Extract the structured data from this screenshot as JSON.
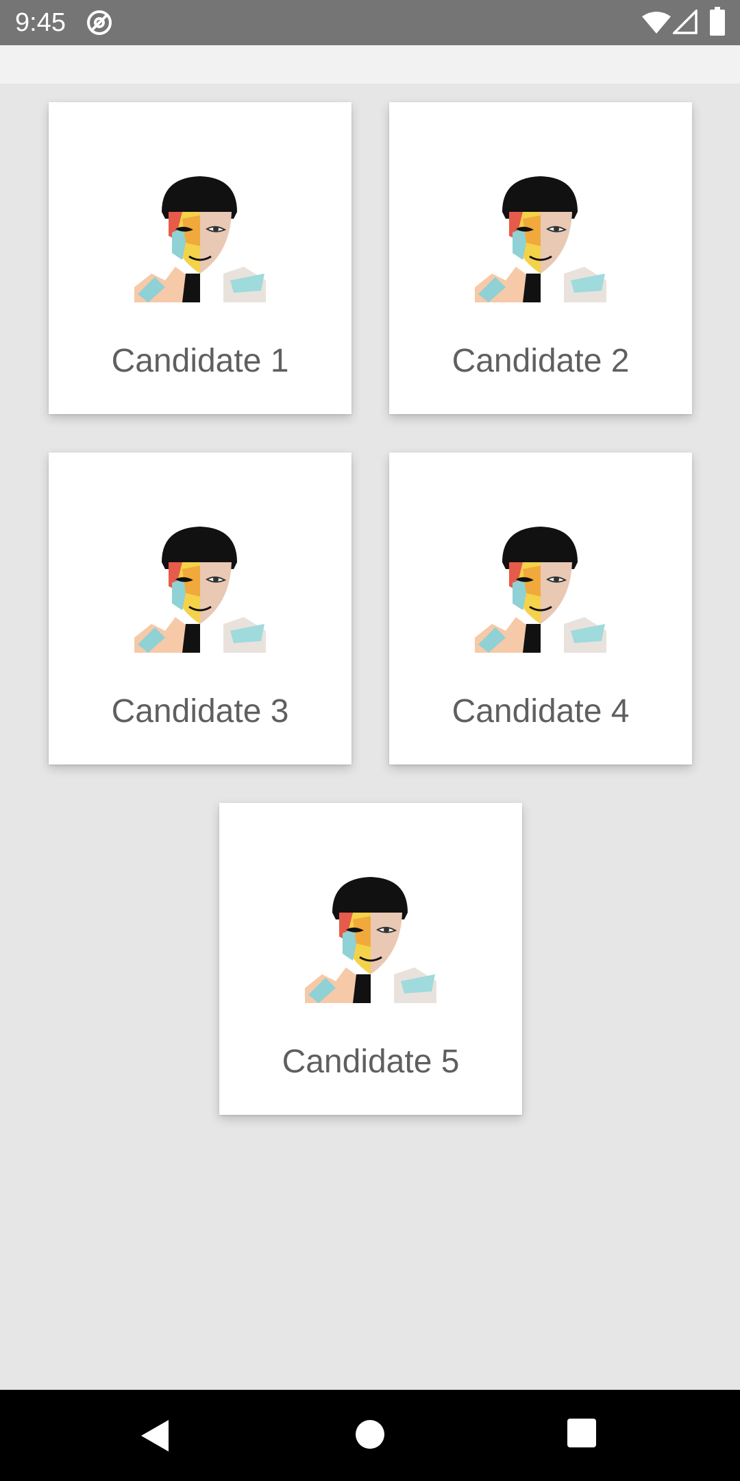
{
  "status_bar": {
    "time": "9:45",
    "icons": [
      "notification-icon",
      "wifi-icon",
      "signal-icon",
      "battery-icon"
    ]
  },
  "candidates": [
    {
      "label": "Candidate 1",
      "avatar": "candidate-photo"
    },
    {
      "label": "Candidate 2",
      "avatar": "candidate-photo"
    },
    {
      "label": "Candidate 3",
      "avatar": "candidate-photo"
    },
    {
      "label": "Candidate 4",
      "avatar": "candidate-photo"
    },
    {
      "label": "Candidate 5",
      "avatar": "candidate-photo"
    }
  ],
  "nav_bar": {
    "icons": [
      "back-icon",
      "home-icon",
      "recents-icon"
    ]
  },
  "colors": {
    "status_bar": "#757575",
    "background": "#e6e6e6",
    "card": "#ffffff",
    "label_text": "#5f5f5f",
    "nav_bar": "#000000"
  }
}
